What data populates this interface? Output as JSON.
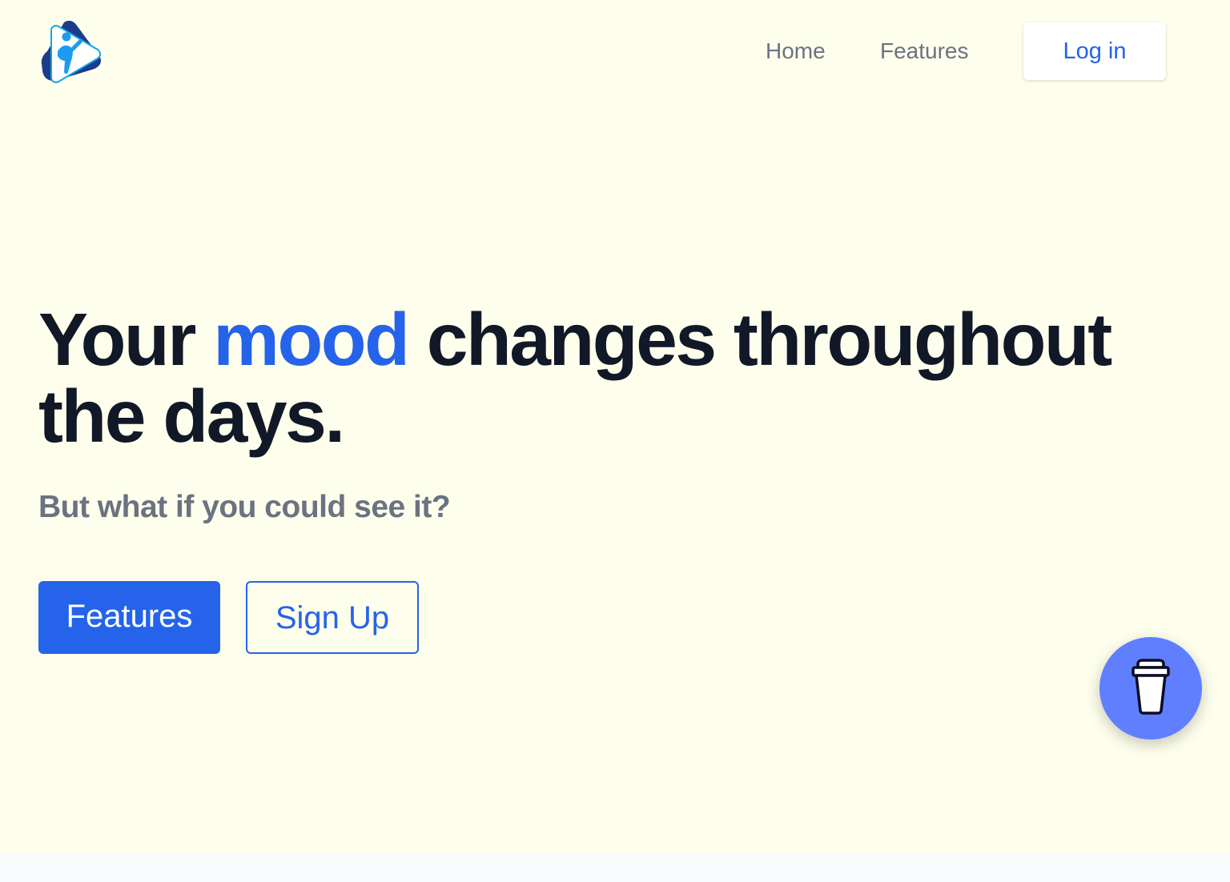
{
  "brand": {
    "logo_icon": "play-triangle-person-logo",
    "colors": {
      "primary": "#2563EB",
      "page_background": "#FEFEEC",
      "text_dark": "#111827",
      "text_muted": "#6B7280",
      "coffee_button": "#5F7FFF"
    }
  },
  "nav": {
    "home_label": "Home",
    "features_label": "Features",
    "login_label": "Log in"
  },
  "hero": {
    "headline_before": "Your ",
    "headline_accent": "mood",
    "headline_after": " changes throughout the days.",
    "subheadline": "But what if you could see it?",
    "primary_button_label": "Features",
    "secondary_button_label": "Sign Up"
  },
  "floating": {
    "coffee_icon": "coffee-cup-icon"
  }
}
